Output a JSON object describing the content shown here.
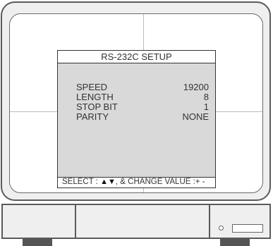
{
  "osd": {
    "title": "RS-232C SETUP",
    "settings": [
      {
        "label": "SPEED",
        "value": "19200"
      },
      {
        "label": "LENGTH",
        "value": "8"
      },
      {
        "label": "STOP BIT",
        "value": "1"
      },
      {
        "label": "PARITY",
        "value": "NONE"
      }
    ],
    "footer": {
      "select_text": "SELECT :",
      "up_symbol": "▲",
      "down_symbol": "▼",
      "change_text": ", & CHANGE VALUE :+ -"
    }
  },
  "colors": {
    "menu_background": "#d9d9d9",
    "bezel": "#efefef",
    "outline": "#5a5a5a"
  }
}
